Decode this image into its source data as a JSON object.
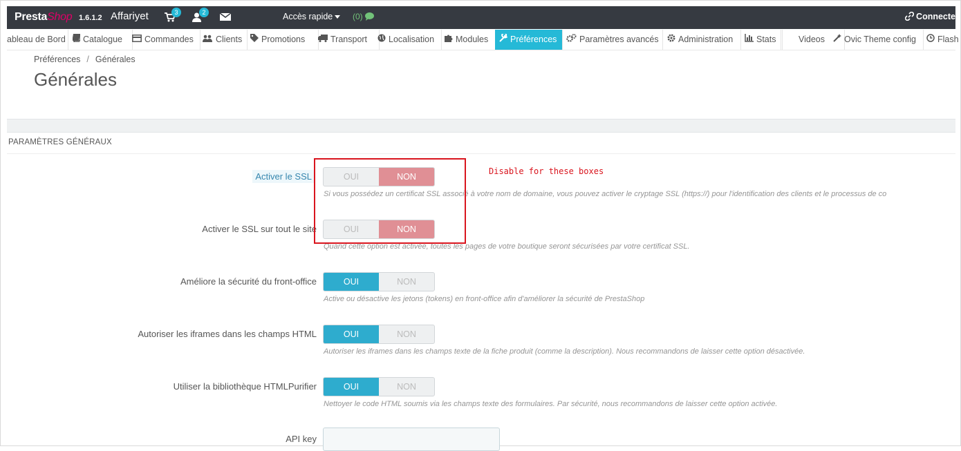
{
  "header": {
    "logo_part1": "Presta",
    "logo_part2": "Shop",
    "version": "1.6.1.2",
    "shop_name": "Affariyet",
    "cart_badge": "3",
    "customer_badge": "2",
    "quick_access": "Accès rapide",
    "messages_count": "(0)",
    "connect": "Connecte"
  },
  "nav": {
    "items": [
      {
        "label": "ableau de Bord",
        "icon": ""
      },
      {
        "label": "Catalogue",
        "icon": "book-icon"
      },
      {
        "label": "Commandes",
        "icon": "credit-card-icon"
      },
      {
        "label": "Clients",
        "icon": "users-icon"
      },
      {
        "label": "Promotions",
        "icon": "tag-icon"
      },
      {
        "label": "Transport",
        "icon": "truck-icon"
      },
      {
        "label": "Localisation",
        "icon": "globe-icon"
      },
      {
        "label": "Modules",
        "icon": "puzzle-icon"
      },
      {
        "label": "Préférences",
        "icon": "wrench-icon"
      },
      {
        "label": "Paramètres avancés",
        "icon": "cogs-icon"
      },
      {
        "label": "Administration",
        "icon": "cog-icon"
      },
      {
        "label": "Stats",
        "icon": "bar-chart-icon"
      },
      {
        "label": "Videos",
        "icon": ""
      },
      {
        "label": "Ovic Theme config",
        "icon": "magic-icon"
      },
      {
        "label": "Flash",
        "icon": "clock-icon"
      }
    ],
    "active_index": 8,
    "active_color": "#25b9d7"
  },
  "breadcrumb": {
    "parent": "Préférences",
    "separator": "/",
    "current": "Générales"
  },
  "page": {
    "title": "Générales",
    "panel_heading": "PARAMÈTRES GÉNÉRAUX"
  },
  "form": {
    "yes_label": "OUI",
    "no_label": "NON",
    "rows": [
      {
        "label": "Activer le SSL",
        "value": "NON",
        "help": "Si vous possédez un certificat SSL associé à votre nom de domaine, vous pouvez activer le cryptage SSL (https://) pour l'identification des clients et le processus de co"
      },
      {
        "label": "Activer le SSL sur tout le site",
        "value": "NON",
        "help": "Quand cette option est activée, toutes les pages de votre boutique seront sécurisées par votre certificat SSL."
      },
      {
        "label": "Améliore la sécurité du front-office",
        "value": "OUI",
        "help": "Active ou désactive les jetons (tokens) en front-office afin d'améliorer la sécurité de PrestaShop"
      },
      {
        "label": "Autoriser les iframes dans les champs HTML",
        "value": "OUI",
        "help": "Autoriser les iframes dans les champs texte de la fiche produit (comme la description). Nous recommandons de laisser cette option désactivée."
      },
      {
        "label": "Utiliser la bibliothèque HTMLPurifier",
        "value": "OUI",
        "help": "Nettoyer le code HTML soumis via les champs texte des formulaires. Par sécurité, nous recommandons de laisser cette option activée."
      }
    ],
    "api_key_label": "API key",
    "api_key_value": ""
  },
  "annotation": {
    "text": "Disable for these boxes",
    "color": "#d9141d"
  },
  "colors": {
    "header_bg": "#363a41",
    "switch_no": "#e08f95",
    "switch_yes": "#2eacce",
    "logo_accent": "#df0067"
  }
}
